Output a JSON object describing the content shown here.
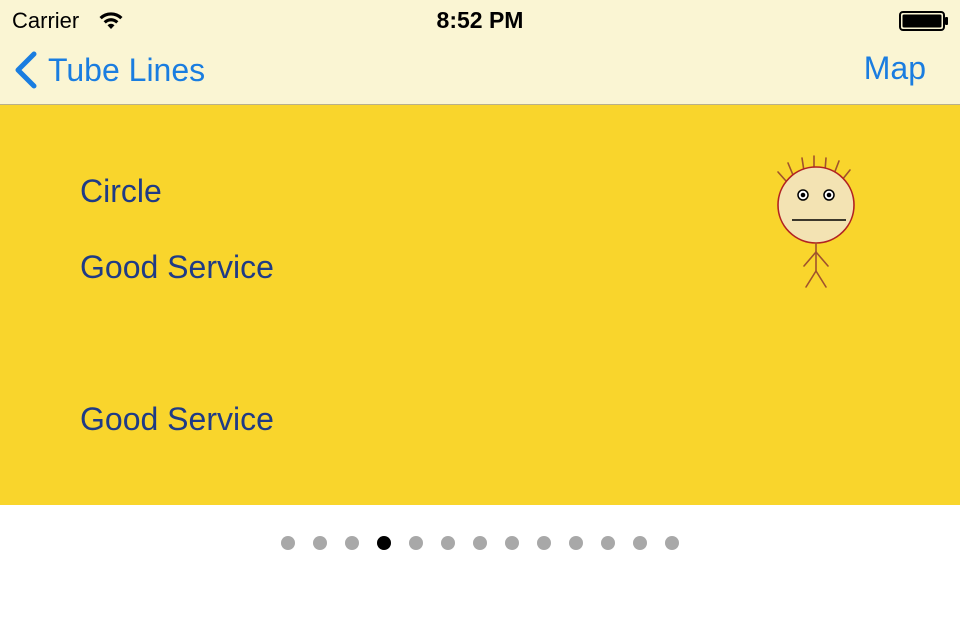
{
  "status_bar": {
    "carrier": "Carrier",
    "time": "8:52 PM",
    "icons": [
      "wifi-icon",
      "battery-icon"
    ]
  },
  "nav": {
    "back_label": "Tube Lines",
    "back_icon": "chevron-left-icon",
    "right_button_label": "Map"
  },
  "line": {
    "name": "Circle",
    "status_primary": "Good Service",
    "status_secondary": "Good Service",
    "mood_icon": "neutral-face-stick-figure-icon"
  },
  "page_indicator": {
    "total": 13,
    "current": 4
  },
  "colors": {
    "accent": "#1a7de0",
    "nav_background": "#faf5d3",
    "line_color": "#f9d52c",
    "text_color": "#1f3b86",
    "dot_inactive": "#a8a8a8",
    "dot_active": "#000000"
  }
}
